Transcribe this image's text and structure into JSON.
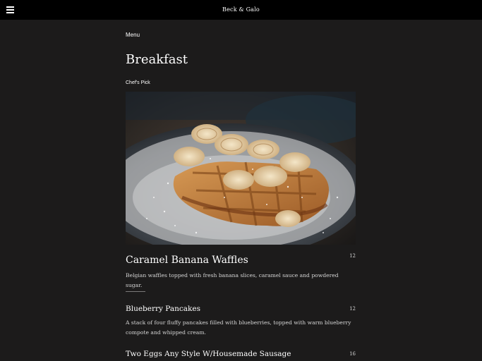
{
  "header": {
    "brand": "Beck & Galo",
    "menu_icon": "hamburger-menu-icon"
  },
  "breadcrumb": "Menu",
  "page_title": "Breakfast",
  "featured": {
    "tag": "Chef's Pick",
    "image": "caramel-banana-waffles-photo"
  },
  "items": [
    {
      "name": "Caramel Banana Waffles",
      "price": "12",
      "description": "Belgian waffles topped with fresh banana slices, caramel sauce and powdered sugar."
    },
    {
      "name": "Blueberry Pancakes",
      "price": "12",
      "description": "A stack of four fluffy pancakes filled with blueberries, topped with warm blueberry compote and whipped cream."
    },
    {
      "name": "Two Eggs Any Style W/Housemade Sausage",
      "price": "16",
      "description": ""
    }
  ],
  "colors": {
    "background": "#1c1b1b",
    "topbar": "#000000",
    "text": "#ffffff"
  }
}
